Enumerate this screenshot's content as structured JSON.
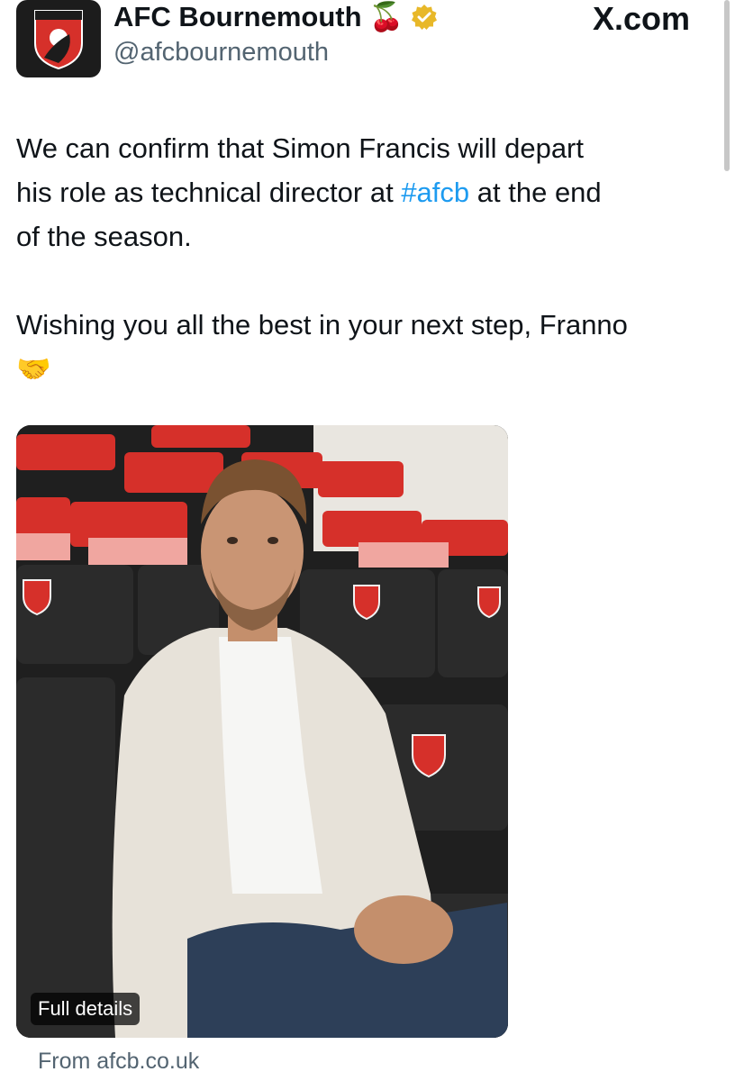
{
  "account": {
    "display_name": "AFC Bournemouth",
    "handle": "@afcbournemouth",
    "emoji": "🍒",
    "verified_icon": "gold-verified-badge",
    "avatar_logo_text": "AFC BOURNEMOUTH"
  },
  "brand": {
    "label": "X.com"
  },
  "tweet": {
    "line1_before": "We can confirm that Simon Francis will depart",
    "line2_before": "his role as technical director at ",
    "hashtag": "#afcb",
    "line2_after": " at the end",
    "line3": "of the season.",
    "line4": "Wishing you all the best in your next step, Franno",
    "emoji": "🤝"
  },
  "media": {
    "badge_label": "Full details",
    "source_label": "From afcb.co.uk"
  },
  "colors": {
    "hashtag": "#1d9bf0",
    "secondary_text": "#536471",
    "verified_gold": "#e8b829",
    "seat_red": "#d6302a"
  }
}
